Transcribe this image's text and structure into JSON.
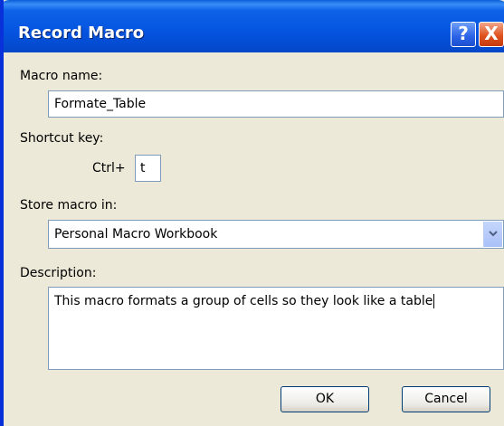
{
  "window": {
    "title": "Record Macro",
    "help_label": "?",
    "close_label": "X"
  },
  "form": {
    "macro_name_label": "Macro name:",
    "macro_name_value": "Formate_Table",
    "shortcut_label": "Shortcut key:",
    "ctrl_prefix": "Ctrl+",
    "shortcut_value": "t",
    "store_label": "Store macro in:",
    "store_value": "Personal Macro Workbook",
    "description_label": "Description:",
    "description_value": "This macro formats a group of cells so they look like a table"
  },
  "buttons": {
    "ok_label": "OK",
    "cancel_label": "Cancel"
  },
  "icons": {
    "dropdown": "chevron-down-icon"
  },
  "colors": {
    "titlebar": "#0554e0",
    "dialog_bg": "#ece9d8",
    "field_border": "#7f9db9",
    "close_button": "#e0531f"
  }
}
